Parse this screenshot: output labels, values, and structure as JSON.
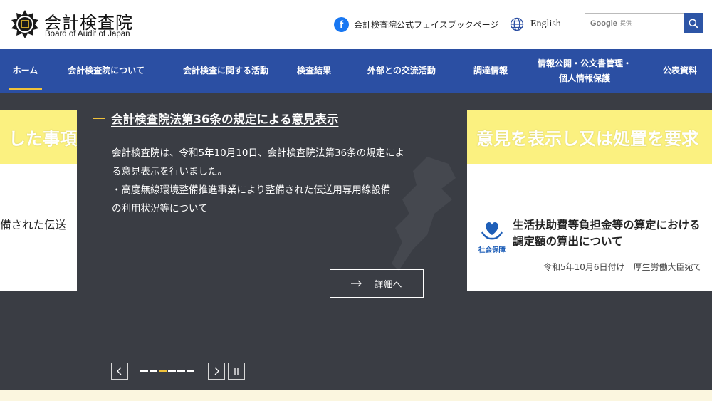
{
  "header": {
    "logo_ja": "会計検査院",
    "logo_en": "Board of Audit of Japan",
    "facebook_label": "会計検査院公式フェイスブックページ",
    "language_label": "English",
    "search": {
      "google_label": "Google",
      "provided_label": "提供"
    }
  },
  "nav": {
    "items": [
      {
        "label": "ホーム",
        "active": true
      },
      {
        "label": "会計検査院について"
      },
      {
        "label": "会計検査に関する活動"
      },
      {
        "label": "検査結果"
      },
      {
        "label": "外部との交流活動"
      },
      {
        "label": "調達情報"
      },
      {
        "label": "情報公開・公文書管理・",
        "label2": "個人情報保護"
      },
      {
        "label": "公表資料"
      }
    ]
  },
  "hero": {
    "left_card": {
      "band_text": "した事項",
      "body_text": "備された伝送"
    },
    "slide": {
      "title": "会計検査院法第36条の規定による意見表示",
      "body_line1": "会計検査院は、令和5年10月10日、会計検査院法第36条の規定によ",
      "body_line2": "る意見表示を行いました。",
      "body_line3": "・高度無線環境整備推進事業により整備された伝送用専用線設備",
      "body_line4": "の利用状況等について",
      "detail_label": "詳細へ"
    },
    "right_card": {
      "band_text": "意見を表示し又は処置を要求",
      "icon_label": "社会保障",
      "title_line1": "生活扶助費等負担金等の算定における",
      "title_line2": "調定額の算出について",
      "date": "令和5年10月6日付け　厚生労働大臣宛て"
    },
    "carousel": {
      "slide_count": 6,
      "active_index": 2
    }
  },
  "colors": {
    "nav_bg": "#2b4fa3",
    "hero_bg": "#3a3d44",
    "accent": "#f0c23a",
    "band_yellow": "#fbf180",
    "facebook_blue": "#1877f2"
  },
  "icons": [
    "emblem-logo",
    "facebook-icon",
    "globe-icon",
    "search-icon",
    "arrow-right-icon",
    "heart-hands-icon",
    "chevron-left-icon",
    "chevron-right-icon",
    "pause-icon"
  ]
}
